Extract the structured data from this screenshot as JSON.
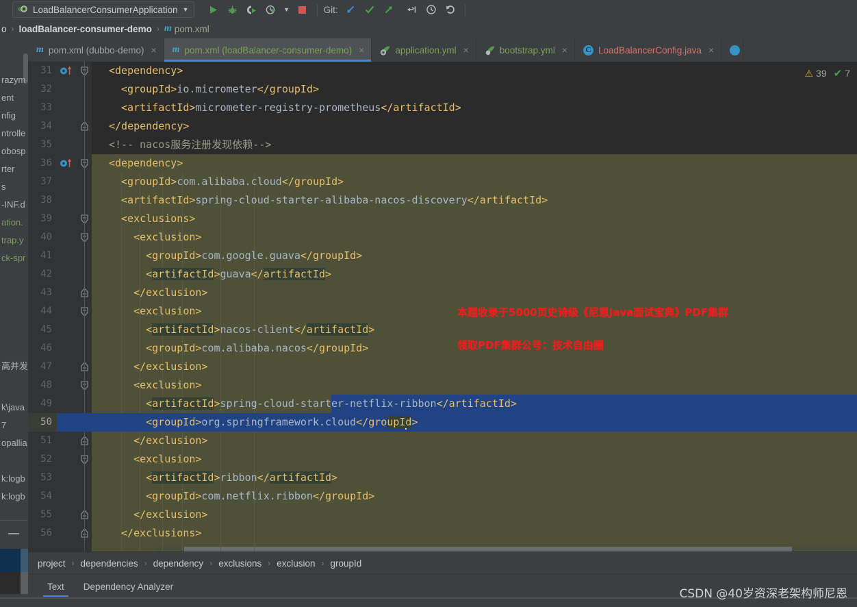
{
  "toolbar": {
    "run_config": "LoadBalancerConsumerApplication",
    "run_config_dropdown": "▼",
    "icons": [
      {
        "name": "run-icon",
        "glyph": "▶"
      },
      {
        "name": "debug-icon",
        "glyph": "🐞"
      },
      {
        "name": "run-with-coverage-icon",
        "glyph": "▶"
      },
      {
        "name": "profiler-icon",
        "glyph": "◔"
      },
      {
        "name": "profiler-dropdown-icon",
        "glyph": "▼"
      },
      {
        "name": "stop-icon",
        "glyph": "■"
      }
    ],
    "git_label": "Git:",
    "git_icons": [
      {
        "name": "git-update-project-icon",
        "glyph": "↙"
      },
      {
        "name": "git-commit-icon",
        "glyph": "✔"
      },
      {
        "name": "git-push-icon",
        "glyph": "↗"
      },
      {
        "name": "git-rollback-icon",
        "glyph": "⇤"
      },
      {
        "name": "git-history-icon",
        "glyph": "◴"
      },
      {
        "name": "undo-icon",
        "glyph": "↺"
      }
    ]
  },
  "navbar": {
    "crumb_truncated": "o",
    "module": "loadBalancer-consumer-demo",
    "file_icon": "m",
    "file": "pom.xml",
    "separator": "›"
  },
  "editor_tabs": [
    {
      "icon": "maven-icon",
      "label": "pom.xml (dubbo-demo)",
      "color": "grey",
      "active": false,
      "close": "×"
    },
    {
      "icon": "maven-icon",
      "label": "pom.xml (loadBalancer-consumer-demo)",
      "color": "green",
      "active": true,
      "close": "×"
    },
    {
      "icon": "yaml-icon",
      "label": "application.yml",
      "color": "green",
      "active": false,
      "close": "×"
    },
    {
      "icon": "yaml-icon",
      "label": "bootstrap.yml",
      "color": "green",
      "active": false,
      "close": "×"
    },
    {
      "icon": "java-class-icon",
      "label": "LoadBalancerConfig.java",
      "color": "red",
      "active": false,
      "close": "×"
    }
  ],
  "inspection_widget": {
    "warning_icon": "⚠",
    "warning_count": "39",
    "ok_icon": "✔",
    "ok_count": "7"
  },
  "code": {
    "first_line": 31,
    "current_line": 50,
    "lines": [
      {
        "n": 31,
        "indent": 2,
        "segs": [
          {
            "t": "<dependency>",
            "c": "tag"
          }
        ]
      },
      {
        "n": 32,
        "indent": 3,
        "segs": [
          {
            "t": "<groupId>",
            "c": "tag"
          },
          {
            "t": "io.micrometer",
            "c": "val"
          },
          {
            "t": "</groupId>",
            "c": "tag"
          }
        ]
      },
      {
        "n": 33,
        "indent": 3,
        "segs": [
          {
            "t": "<artifactId>",
            "c": "tag"
          },
          {
            "t": "micrometer-registry-prometheus",
            "c": "val"
          },
          {
            "t": "</artifactId>",
            "c": "tag"
          }
        ]
      },
      {
        "n": 34,
        "indent": 2,
        "segs": [
          {
            "t": "</dependency>",
            "c": "tag"
          }
        ]
      },
      {
        "n": 35,
        "indent": 2,
        "segs": [
          {
            "t": "<!-- nacos服务注册发现依赖-->",
            "c": "cmt"
          }
        ]
      },
      {
        "n": 36,
        "indent": 2,
        "segs": [
          {
            "t": "<dependency>",
            "c": "tag"
          }
        ]
      },
      {
        "n": 37,
        "indent": 3,
        "segs": [
          {
            "t": "<groupId>",
            "c": "tag"
          },
          {
            "t": "com.alibaba.cloud",
            "c": "val"
          },
          {
            "t": "</groupId>",
            "c": "tag"
          }
        ]
      },
      {
        "n": 38,
        "indent": 3,
        "segs": [
          {
            "t": "<artifactId>",
            "c": "tag"
          },
          {
            "t": "spring-cloud-starter-alibaba-nacos-discovery",
            "c": "val"
          },
          {
            "t": "</artifactId>",
            "c": "tag"
          }
        ]
      },
      {
        "n": 39,
        "indent": 3,
        "segs": [
          {
            "t": "<exclusions>",
            "c": "tag"
          }
        ]
      },
      {
        "n": 40,
        "indent": 4,
        "segs": [
          {
            "t": "<exclusion>",
            "c": "tag"
          }
        ]
      },
      {
        "n": 41,
        "indent": 5,
        "segs": [
          {
            "t": "<groupId>",
            "c": "tag"
          },
          {
            "t": "com.google.guava",
            "c": "val"
          },
          {
            "t": "</groupId>",
            "c": "tag"
          }
        ]
      },
      {
        "n": 42,
        "indent": 5,
        "segs": [
          {
            "t": "<",
            "c": "tag"
          },
          {
            "t": "artifactId",
            "c": "tag hl"
          },
          {
            "t": ">",
            "c": "tag"
          },
          {
            "t": "guava",
            "c": "val"
          },
          {
            "t": "</",
            "c": "tag"
          },
          {
            "t": "artifactId",
            "c": "tag hl"
          },
          {
            "t": ">",
            "c": "tag"
          }
        ]
      },
      {
        "n": 43,
        "indent": 4,
        "segs": [
          {
            "t": "</exclusion>",
            "c": "tag"
          }
        ]
      },
      {
        "n": 44,
        "indent": 4,
        "segs": [
          {
            "t": "<exclusion>",
            "c": "tag"
          }
        ]
      },
      {
        "n": 45,
        "indent": 5,
        "segs": [
          {
            "t": "<",
            "c": "tag"
          },
          {
            "t": "artifactId",
            "c": "tag hl"
          },
          {
            "t": ">",
            "c": "tag"
          },
          {
            "t": "nacos-client",
            "c": "val"
          },
          {
            "t": "</",
            "c": "tag"
          },
          {
            "t": "artifactId",
            "c": "tag hl"
          },
          {
            "t": ">",
            "c": "tag"
          }
        ]
      },
      {
        "n": 46,
        "indent": 5,
        "segs": [
          {
            "t": "<groupId>",
            "c": "tag"
          },
          {
            "t": "com.alibaba.nacos",
            "c": "val"
          },
          {
            "t": "</groupId>",
            "c": "tag"
          }
        ]
      },
      {
        "n": 47,
        "indent": 4,
        "segs": [
          {
            "t": "</exclusion>",
            "c": "tag"
          }
        ]
      },
      {
        "n": 48,
        "indent": 4,
        "segs": [
          {
            "t": "<exclusion>",
            "c": "tag"
          }
        ]
      },
      {
        "n": 49,
        "indent": 5,
        "segs": [
          {
            "t": "<",
            "c": "tag"
          },
          {
            "t": "artifactId",
            "c": "tag hl"
          },
          {
            "t": ">",
            "c": "tag"
          },
          {
            "t": "spring-cloud-starter-netflix-ribbon",
            "c": "val"
          },
          {
            "t": "</artifactId>",
            "c": "tag"
          }
        ]
      },
      {
        "n": 50,
        "indent": 5,
        "segs": [
          {
            "t": "<groupId>",
            "c": "tag"
          },
          {
            "t": "org.springframework.cloud",
            "c": "val"
          },
          {
            "t": "</gro",
            "c": "tag"
          },
          {
            "t": "upId",
            "c": "tag hl"
          },
          {
            "t": ">",
            "c": "tag"
          }
        ]
      },
      {
        "n": 51,
        "indent": 4,
        "segs": [
          {
            "t": "</exclusion>",
            "c": "tag"
          }
        ]
      },
      {
        "n": 52,
        "indent": 4,
        "segs": [
          {
            "t": "<exclusion>",
            "c": "tag"
          }
        ]
      },
      {
        "n": 53,
        "indent": 5,
        "segs": [
          {
            "t": "<",
            "c": "tag"
          },
          {
            "t": "artifactId",
            "c": "tag hl"
          },
          {
            "t": ">",
            "c": "tag"
          },
          {
            "t": "ribbon",
            "c": "val"
          },
          {
            "t": "</",
            "c": "tag"
          },
          {
            "t": "artifactId",
            "c": "tag hl"
          },
          {
            "t": ">",
            "c": "tag"
          }
        ]
      },
      {
        "n": 54,
        "indent": 5,
        "segs": [
          {
            "t": "<groupId>",
            "c": "tag"
          },
          {
            "t": "com.netflix.ribbon",
            "c": "val"
          },
          {
            "t": "</groupId>",
            "c": "tag"
          }
        ]
      },
      {
        "n": 55,
        "indent": 4,
        "segs": [
          {
            "t": "</exclusion>",
            "c": "tag"
          }
        ]
      },
      {
        "n": 56,
        "indent": 3,
        "segs": [
          {
            "t": "</exclusions>",
            "c": "tag"
          }
        ]
      }
    ],
    "run_markers": [
      31,
      36
    ],
    "fold_open": [
      31,
      36,
      39,
      40,
      44,
      48,
      52
    ],
    "fold_close": [
      34,
      43,
      47,
      51,
      55,
      56
    ]
  },
  "overlay_annotation": {
    "line1": "本题收录于5000页史诗级《尼恩Java面试宝典》PDF集群",
    "line2": "领取PDF集群公号：技术自由圈",
    "color": "#e8201f"
  },
  "left_panel": {
    "rows": [
      "razym",
      "ent",
      "nfig",
      "ntrolle",
      "obosp",
      "rter",
      "s",
      "-INF.d",
      "ation.",
      "trap.y",
      "ck-spr"
    ],
    "green_rows": [
      8,
      9,
      10
    ],
    "rows_lower": [
      "高并发",
      "k\\java",
      "7",
      "opallia",
      "k:logb",
      "k:logb"
    ]
  },
  "breadcrumb_bar": {
    "items": [
      "project",
      "dependencies",
      "dependency",
      "exclusions",
      "exclusion",
      "groupId"
    ],
    "separator": "›"
  },
  "bottom_tabs": [
    {
      "label": "Text",
      "selected": true
    },
    {
      "label": "Dependency Analyzer",
      "selected": false
    }
  ],
  "watermark": "CSDN @40岁资深老架构师尼恩",
  "colors": {
    "editor_bg": "#2b2b2b",
    "olive_highlight": "#4e5137",
    "selection": "#214283",
    "tag": "#e8bf6a",
    "value": "#a9b7c6",
    "comment": "#9a9a87",
    "accent": "#4a88c7"
  }
}
